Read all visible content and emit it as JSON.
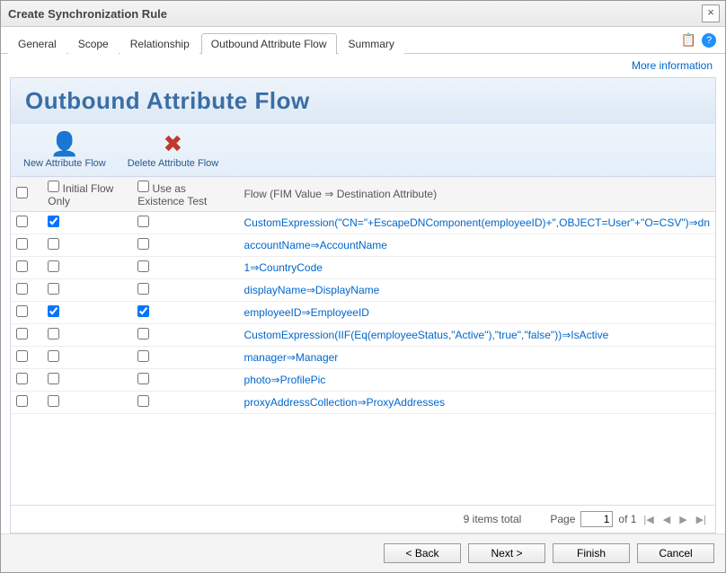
{
  "dialog_title": "Create Synchronization Rule",
  "close_label": "×",
  "tabs": [
    "General",
    "Scope",
    "Relationship",
    "Outbound Attribute Flow",
    "Summary"
  ],
  "active_tab_index": 3,
  "right_icons": {
    "clipboard_label": "📋",
    "help_label": "?"
  },
  "more_info": "More information",
  "panel": {
    "title": "Outbound Attribute Flow",
    "tools": {
      "new_flow": {
        "label": "New Attribute Flow",
        "icon": "👤"
      },
      "delete_flow": {
        "label": "Delete Attribute Flow",
        "icon": "✖"
      }
    }
  },
  "columns": {
    "select": "",
    "initial": "Initial Flow Only",
    "existence": "Use as Existence Test",
    "flow": "Flow (FIM Value ⇒ Destination Attribute)"
  },
  "rows": [
    {
      "sel": false,
      "initial": true,
      "existence": false,
      "flow": "CustomExpression(\"CN=\"+EscapeDNComponent(employeeID)+\",OBJECT=User\"+\"O=CSV\")⇒dn"
    },
    {
      "sel": false,
      "initial": false,
      "existence": false,
      "flow": "accountName⇒AccountName"
    },
    {
      "sel": false,
      "initial": false,
      "existence": false,
      "flow": "1⇒CountryCode"
    },
    {
      "sel": false,
      "initial": false,
      "existence": false,
      "flow": "displayName⇒DisplayName"
    },
    {
      "sel": false,
      "initial": true,
      "existence": true,
      "flow": "employeeID⇒EmployeeID"
    },
    {
      "sel": false,
      "initial": false,
      "existence": false,
      "flow": "CustomExpression(IIF(Eq(employeeStatus,\"Active\"),\"true\",\"false\"))⇒IsActive"
    },
    {
      "sel": false,
      "initial": false,
      "existence": false,
      "flow": "manager⇒Manager"
    },
    {
      "sel": false,
      "initial": false,
      "existence": false,
      "flow": "photo⇒ProfilePic"
    },
    {
      "sel": false,
      "initial": false,
      "existence": false,
      "flow": "proxyAddressCollection⇒ProxyAddresses"
    }
  ],
  "pager": {
    "items_total": "9 items total",
    "page_label": "Page",
    "page_value": "1",
    "of_label": "of 1",
    "first": "|◀",
    "prev": "◀",
    "next": "▶",
    "last": "▶|"
  },
  "footer": {
    "back": "< Back",
    "next": "Next >",
    "finish": "Finish",
    "cancel": "Cancel"
  }
}
